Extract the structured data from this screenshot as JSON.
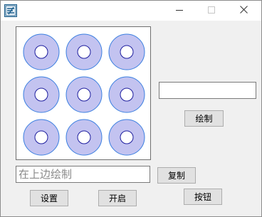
{
  "window": {
    "title": "",
    "controls": {
      "minimize_icon": "minimize-icon",
      "maximize_icon": "maximize-icon",
      "close_icon": "close-icon"
    }
  },
  "canvas": {
    "grid": {
      "rows": 3,
      "cols": 3
    },
    "ring_fill": "#c3c3f0",
    "ring_stroke": "#3a7fe0",
    "hole_stroke": "#1c1c9e"
  },
  "right_panel": {
    "input_value": "",
    "draw_button": "绘制"
  },
  "bottom": {
    "text_field": "在上边绘制",
    "copy_button": "复制",
    "settings_button": "设置",
    "start_button": "开启",
    "generic_button": "按钮"
  }
}
